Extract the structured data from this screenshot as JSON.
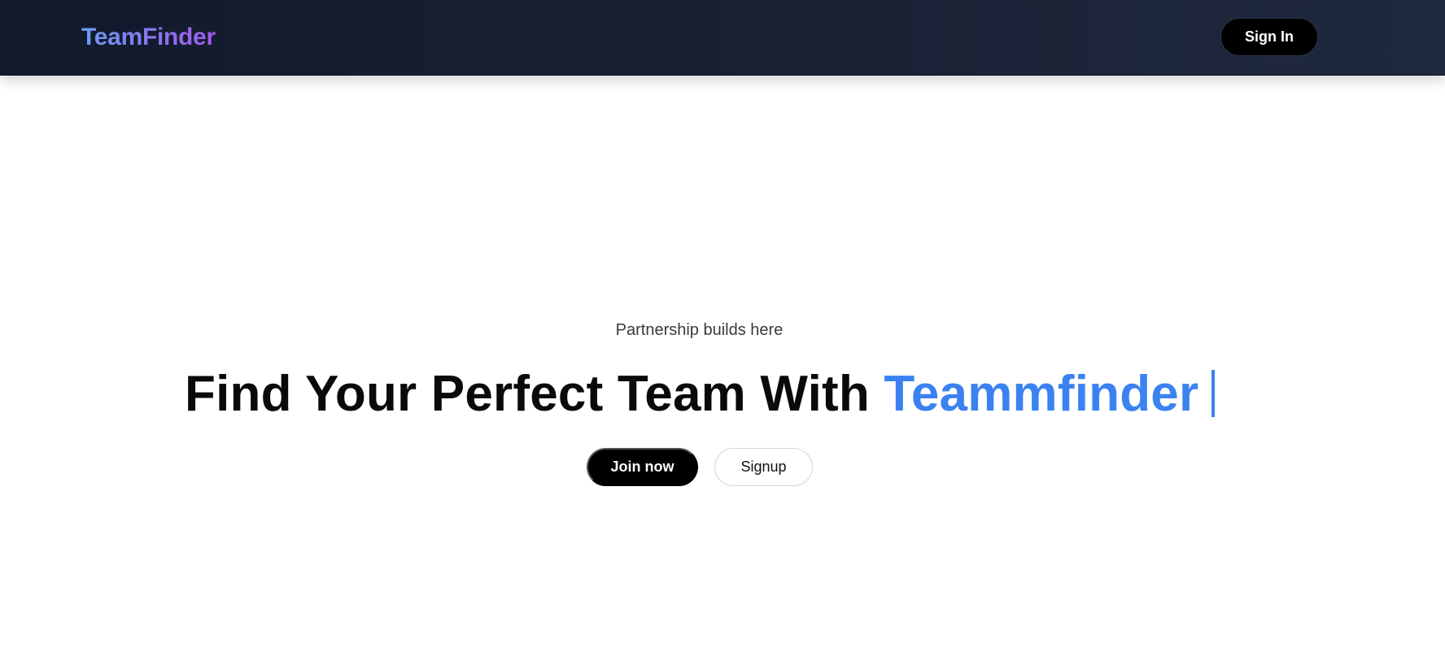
{
  "header": {
    "logo_text": "TeamFinder",
    "sign_in_label": "Sign In"
  },
  "hero": {
    "tagline": "Partnership builds here",
    "headline_main": "Find Your Perfect Team With ",
    "headline_accent": "Teammfinder",
    "join_label": "Join now",
    "signup_label": "Signup"
  },
  "colors": {
    "nav_background": "#111a2c",
    "accent_blue": "#3b82f0",
    "logo_gradient_start": "#6c9cf4",
    "logo_gradient_end": "#a35bea",
    "button_primary": "#000000"
  }
}
